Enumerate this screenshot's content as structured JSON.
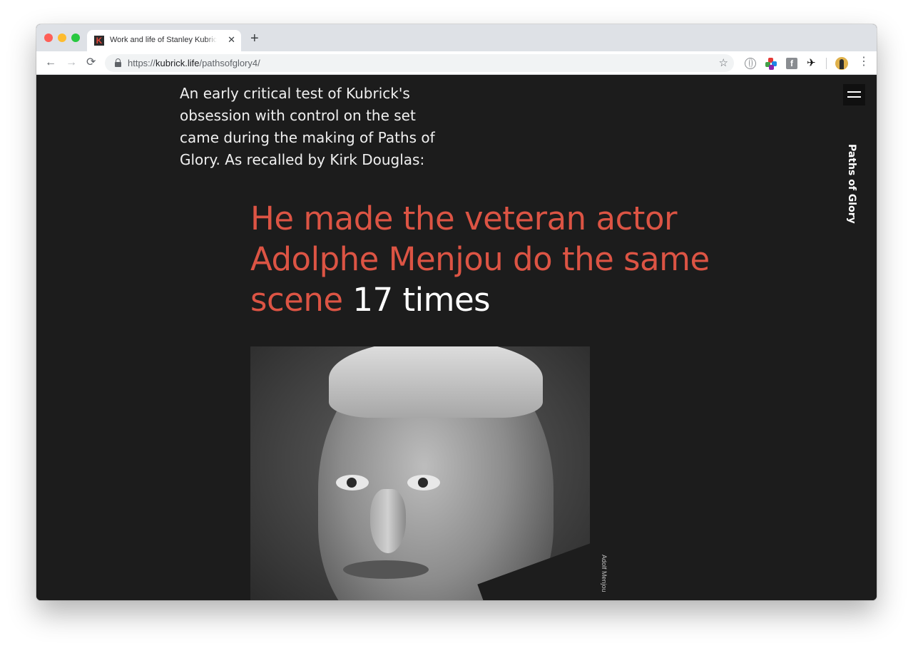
{
  "browser": {
    "tab": {
      "title": "Work and life of Stanley Kubrick",
      "favicon_letter": "K",
      "close_glyph": "✕"
    },
    "new_tab_glyph": "+",
    "nav": {
      "back": "←",
      "forward": "→",
      "reload": "⟳"
    },
    "url": {
      "scheme": "https://",
      "host": "kubrick.life",
      "path": "/pathsofglory4/"
    },
    "star_glyph": "☆",
    "extensions": [
      "globe-icon",
      "color-wheel-icon",
      "facebook-icon",
      "bird-icon"
    ],
    "menu_glyph": "⋮"
  },
  "page": {
    "intro": "An early critical test of Kubrick's obsession with control on the set came during the making of Paths of Glory. As recalled by Kirk Douglas:",
    "quote": {
      "red": "He made the veteran actor Adolphe Menjou do the same scene",
      "white": "17 times"
    },
    "section_label": "Paths of Glory",
    "photo_caption": "Adolf Menjou"
  },
  "colors": {
    "background": "#1c1c1c",
    "quote_accent": "#dc5444",
    "text": "#f0f0f0"
  }
}
